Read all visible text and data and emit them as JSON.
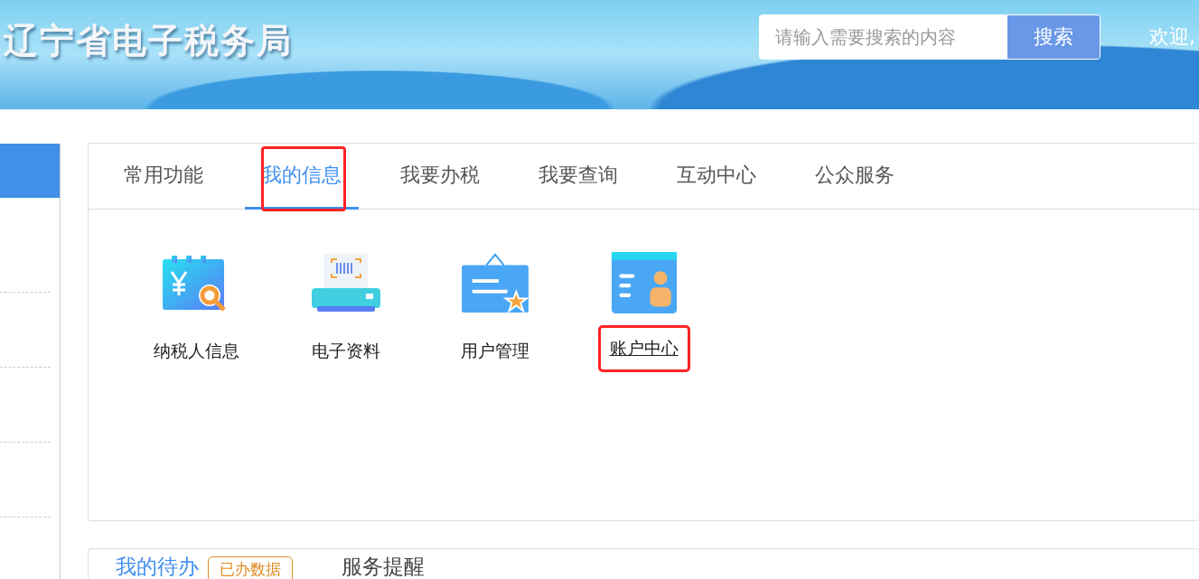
{
  "header": {
    "title": "辽宁省电子税务局",
    "search": {
      "placeholder": "请输入需要搜索的内容",
      "button": "搜索"
    },
    "welcome": "欢迎,"
  },
  "sidebar": {
    "items": [
      {
        "selected": true
      },
      {
        "selected": false
      },
      {
        "selected": false
      },
      {
        "selected": false
      },
      {
        "selected": false
      }
    ]
  },
  "tabs": [
    {
      "label": "常用功能",
      "selected": false,
      "highlighted": false
    },
    {
      "label": "我的信息",
      "selected": true,
      "highlighted": true
    },
    {
      "label": "我要办税",
      "selected": false,
      "highlighted": false
    },
    {
      "label": "我要查询",
      "selected": false,
      "highlighted": false
    },
    {
      "label": "互动中心",
      "selected": false,
      "highlighted": false
    },
    {
      "label": "公众服务",
      "selected": false,
      "highlighted": false
    }
  ],
  "functions": [
    {
      "kind": "taxpayer",
      "label": "纳税人信息",
      "hovered": false,
      "highlighted": false
    },
    {
      "kind": "documents",
      "label": "电子资料",
      "hovered": false,
      "highlighted": false
    },
    {
      "kind": "users",
      "label": "用户管理",
      "hovered": false,
      "highlighted": false
    },
    {
      "kind": "account",
      "label": "账户中心",
      "hovered": true,
      "highlighted": true
    }
  ],
  "lower_panel": {
    "tabs": [
      {
        "label": "我的待办",
        "selected": true,
        "badge": "已办数据"
      },
      {
        "label": "服务提醒",
        "selected": false
      }
    ]
  }
}
